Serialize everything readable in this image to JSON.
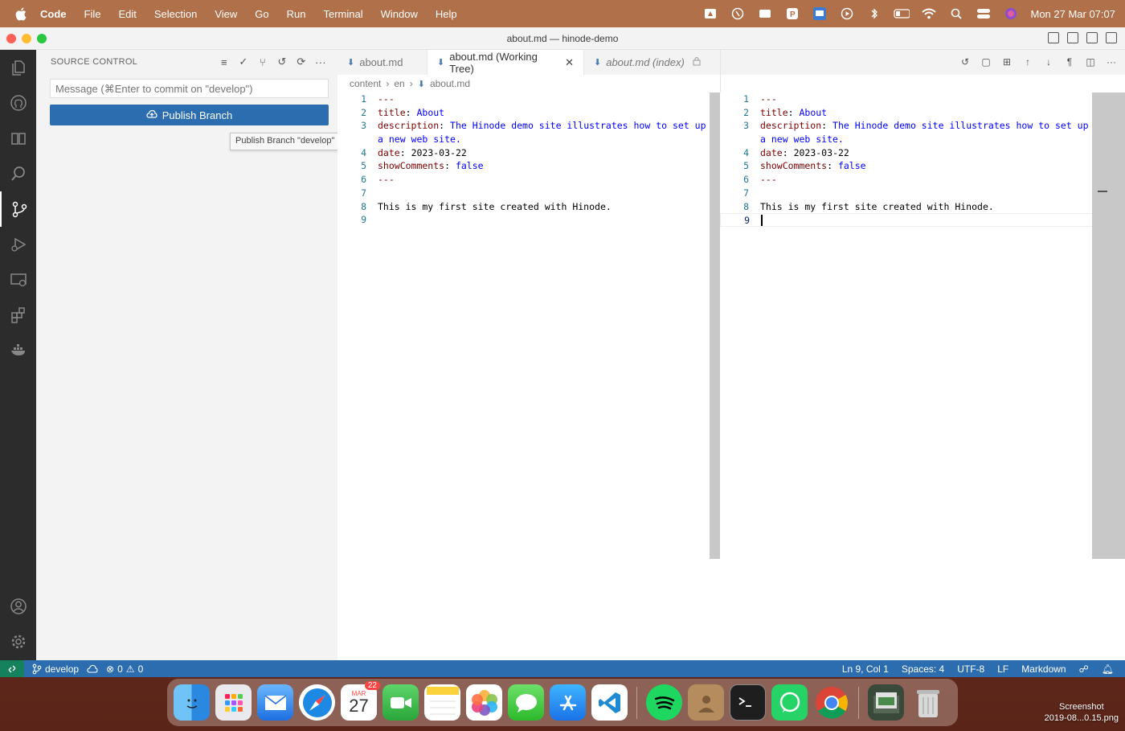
{
  "menubar": {
    "app": "Code",
    "items": [
      "File",
      "Edit",
      "Selection",
      "View",
      "Go",
      "Run",
      "Terminal",
      "Window",
      "Help"
    ],
    "clock": "Mon 27 Mar  07:07"
  },
  "window": {
    "title": "about.md — hinode-demo"
  },
  "sidebar": {
    "header": "SOURCE CONTROL",
    "message_placeholder": "Message (⌘Enter to commit on \"develop\")",
    "publish_label": "Publish Branch",
    "tooltip": "Publish Branch \"develop\""
  },
  "tabs": [
    {
      "label": "about.md"
    },
    {
      "label": "about.md (Working Tree)"
    },
    {
      "label": "about.md (index)"
    }
  ],
  "breadcrumb": [
    "content",
    "en",
    "about.md"
  ],
  "code": {
    "lines": [
      {
        "n": "1",
        "k": "---",
        "v": ""
      },
      {
        "n": "2",
        "k": "title",
        "sep": ": ",
        "v": "About"
      },
      {
        "n": "3",
        "k": "description",
        "sep": ": ",
        "v": "The Hinode demo site illustrates how to set up"
      },
      {
        "n": "",
        "k": "",
        "v": "a new web site."
      },
      {
        "n": "4",
        "k": "date",
        "sep": ": ",
        "v": "2023-03-22"
      },
      {
        "n": "5",
        "k": "showComments",
        "sep": ": ",
        "v": "false"
      },
      {
        "n": "6",
        "k": "---",
        "v": ""
      },
      {
        "n": "7",
        "k": "",
        "v": ""
      },
      {
        "n": "8",
        "t": "This is my first site created with Hinode."
      },
      {
        "n": "9",
        "t": ""
      }
    ]
  },
  "status": {
    "branch": "develop",
    "errors": "0",
    "warnings": "0",
    "position": "Ln 9, Col 1",
    "spaces": "Spaces: 4",
    "encoding": "UTF-8",
    "eol": "LF",
    "language": "Markdown"
  },
  "dock": {
    "calendar_month": "MAR",
    "calendar_day": "27",
    "calendar_badge": "22"
  },
  "desktop": {
    "file_line1": "Screenshot",
    "file_line2": "2019-08...0.15.png"
  }
}
